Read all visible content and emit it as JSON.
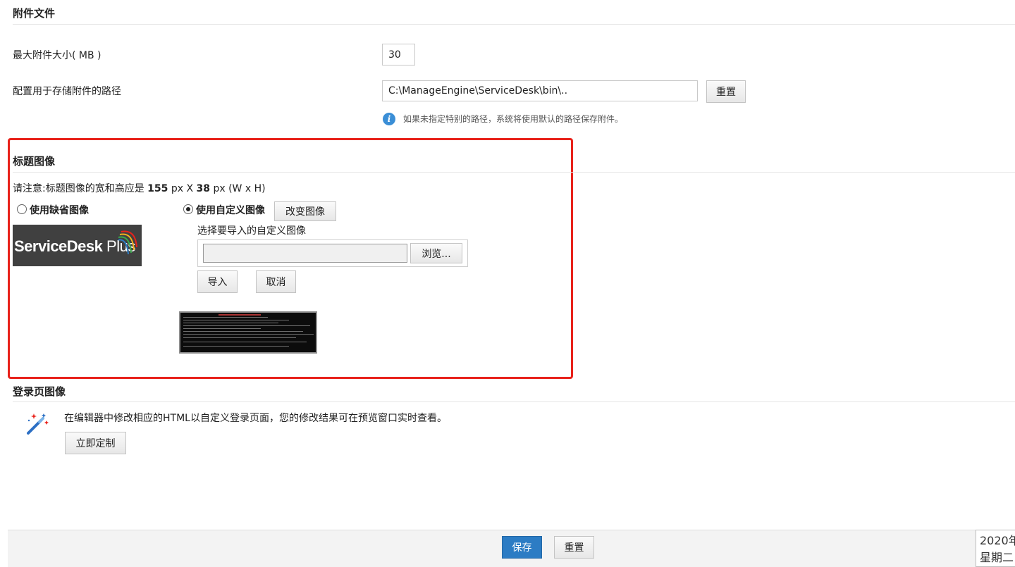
{
  "attachments": {
    "title": "附件文件",
    "max_size_label": "最大附件大小( MB )",
    "max_size_value": "30",
    "path_label": "配置用于存储附件的路径",
    "path_value": "C:\\ManageEngine\\ServiceDesk\\bin\\..",
    "reset_label": "重置",
    "hint": "如果未指定特别的路径，系统将使用默认的路径保存附件。"
  },
  "header_image": {
    "title": "标题图像",
    "note_prefix": "请注意:标题图像的宽和高应是",
    "note_width": "155",
    "note_px1": "px X",
    "note_height": "38",
    "note_suffix": "px (W x H)",
    "default_option": "使用缺省图像",
    "custom_option": "使用自定义图像",
    "change_image": "改变图像",
    "select_label": "选择要导入的自定义图像",
    "browse": "浏览...",
    "import": "导入",
    "cancel": "取消",
    "selected": "custom",
    "logo_text_bold": "ServiceDesk",
    "logo_text_light": "Plus"
  },
  "login_image": {
    "title": "登录页图像",
    "desc": "在编辑器中修改相应的HTML以自定义登录页面，您的修改结果可在预览窗口实时查看。",
    "customize": "立即定制"
  },
  "footer": {
    "save": "保存",
    "reset": "重置",
    "date_line1": "2020年",
    "date_line2": "星期二"
  },
  "colors": {
    "highlight_border": "#e8221b",
    "primary_button": "#2c7cc4",
    "info_icon": "#3a8ed6"
  }
}
